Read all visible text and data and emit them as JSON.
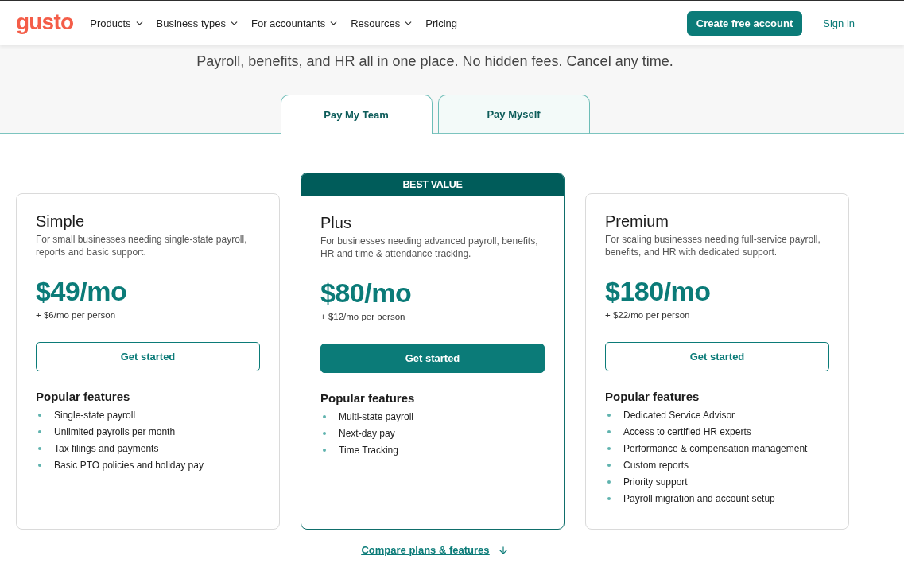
{
  "header": {
    "logo": "gusto",
    "nav": [
      {
        "label": "Products",
        "has_menu": true
      },
      {
        "label": "Business types",
        "has_menu": true
      },
      {
        "label": "For accountants",
        "has_menu": true
      },
      {
        "label": "Resources",
        "has_menu": true
      },
      {
        "label": "Pricing",
        "has_menu": false
      }
    ],
    "cta": "Create free account",
    "sign_in": "Sign in"
  },
  "hero": {
    "subtitle": "Payroll, benefits, and HR all in one place. No hidden fees. Cancel any time."
  },
  "tabs": [
    {
      "label": "Pay My Team",
      "selected": true
    },
    {
      "label": "Pay Myself",
      "selected": false
    }
  ],
  "plans": [
    {
      "name": "Simple",
      "featured": false,
      "description": "For small businesses needing single-state payroll, reports and basic support.",
      "price": "$49/mo",
      "per_person": "+ $6/mo per person",
      "button": "Get started",
      "features_heading": "Popular features",
      "features": [
        "Single-state payroll",
        "Unlimited payrolls per month",
        "Tax filings and payments",
        "Basic PTO policies and holiday pay"
      ]
    },
    {
      "name": "Plus",
      "featured": true,
      "badge": "BEST VALUE",
      "description": "For businesses needing advanced payroll, benefits, HR and time & attendance tracking.",
      "price": "$80/mo",
      "per_person": "+ $12/mo per person",
      "button": "Get started",
      "features_heading": "Popular features",
      "features": [
        "Multi-state payroll",
        "Next-day pay",
        "Time Tracking"
      ]
    },
    {
      "name": "Premium",
      "featured": false,
      "description": "For scaling businesses needing full-service payroll, benefits, and HR with dedicated support.",
      "price": "$180/mo",
      "per_person": "+ $22/mo per person",
      "button": "Get started",
      "features_heading": "Popular features",
      "features": [
        "Dedicated Service Advisor",
        "Access to certified HR experts",
        "Performance & compensation management",
        "Custom reports",
        "Priority support",
        "Payroll migration and account setup"
      ]
    }
  ],
  "compare_link": "Compare plans & features"
}
